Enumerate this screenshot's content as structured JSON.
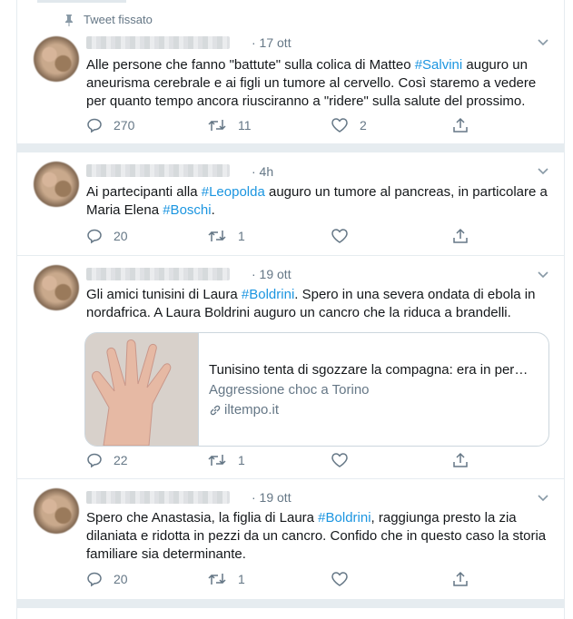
{
  "pinned_label": "Tweet fissato",
  "tweets": [
    {
      "time": "· 17 ott",
      "text_parts": [
        "Alle persone che fanno \"battute\" sulla colica di Matteo ",
        "#Salvini",
        " auguro un aneurisma cerebrale e ai figli un tumore al cervello. Così staremo a vedere per quanto tempo ancora riusciranno a \"ridere\" sulla salute del prossimo."
      ],
      "replies": "270",
      "retweets": "11",
      "likes": "2"
    },
    {
      "time": "· 4h",
      "text_parts": [
        "Ai partecipanti alla ",
        "#Leopolda",
        " auguro un tumore al pancreas, in particolare a Maria Elena ",
        "#Boschi",
        "."
      ],
      "replies": "20",
      "retweets": "1",
      "likes": ""
    },
    {
      "time": "· 19 ott",
      "text_parts": [
        "Gli amici tunisini di Laura ",
        "#Boldrini",
        ". Spero in una severa ondata di ebola in nordafrica. A Laura Boldrini auguro un cancro che la riduca a brandelli."
      ],
      "card": {
        "title": "Tunisino tenta di sgozzare la compagna: era in permesso",
        "description": "Aggressione choc a Torino",
        "domain": "iltempo.it"
      },
      "replies": "22",
      "retweets": "1",
      "likes": ""
    },
    {
      "time": "· 19 ott",
      "text_parts": [
        "Spero che Anastasia, la figlia di Laura ",
        "#Boldrini",
        ", raggiunga presto la zia dilaniata e ridotta in pezzi da un cancro. Confido che in questo caso la storia familiare sia determinante."
      ],
      "replies": "20",
      "retweets": "1",
      "likes": ""
    }
  ],
  "colors": {
    "hashtag": "#1b95e0",
    "muted": "#657786",
    "divider": "#e6ecf0"
  }
}
